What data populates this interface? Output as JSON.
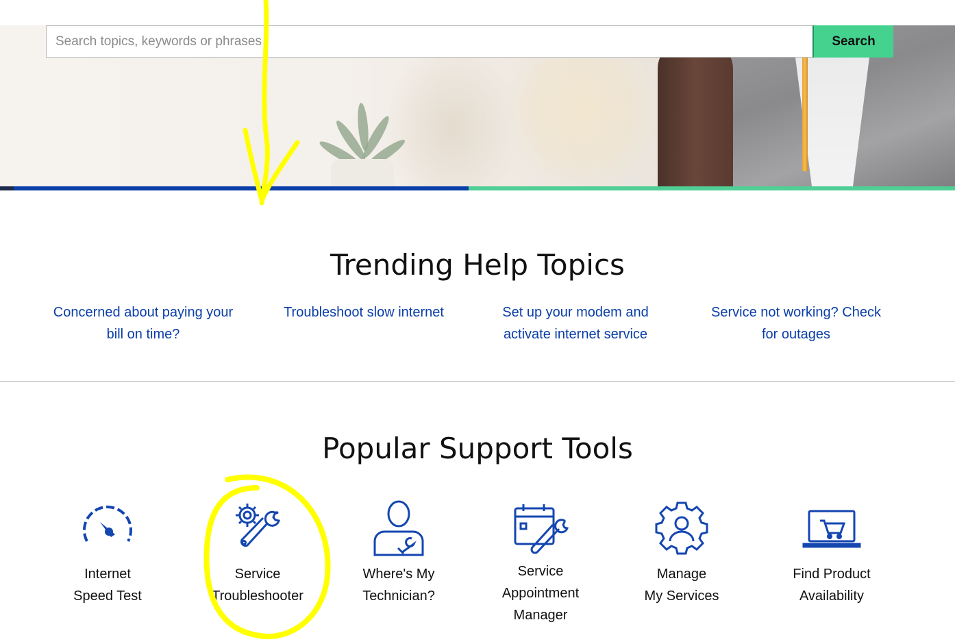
{
  "search": {
    "placeholder": "Search topics, keywords or phrases",
    "button_label": "Search"
  },
  "colors": {
    "brand_blue": "#0a3ea8",
    "accent_green": "#44d28e",
    "annotation_yellow": "#ffff00"
  },
  "trending": {
    "title": "Trending Help Topics",
    "topics": [
      {
        "label": "Concerned about paying your bill on time?",
        "line1": "Concerned about paying your",
        "line2": "bill on time?"
      },
      {
        "label": "Troubleshoot slow internet",
        "line1": "Troubleshoot slow internet",
        "line2": ""
      },
      {
        "label": "Set up your modem and activate internet service",
        "line1": "Set up your modem and",
        "line2": "activate internet service"
      },
      {
        "label": "Service not working? Check for outages",
        "line1": "Service not working? Check",
        "line2": "for outages"
      }
    ]
  },
  "tools": {
    "title": "Popular Support Tools",
    "items": [
      {
        "icon": "speedometer-icon",
        "line1": "Internet",
        "line2": "Speed Test",
        "line3": ""
      },
      {
        "icon": "gear-wrench-icon",
        "line1": "Service",
        "line2": "Troubleshooter",
        "line3": ""
      },
      {
        "icon": "technician-icon",
        "line1": "Where's My",
        "line2": "Technician?",
        "line3": ""
      },
      {
        "icon": "calendar-wrench-icon",
        "line1": "Service",
        "line2": "Appointment",
        "line3": "Manager"
      },
      {
        "icon": "user-gear-icon",
        "line1": "Manage",
        "line2": "My Services",
        "line3": ""
      },
      {
        "icon": "laptop-cart-icon",
        "line1": "Find Product",
        "line2": "Availability",
        "line3": ""
      }
    ]
  }
}
